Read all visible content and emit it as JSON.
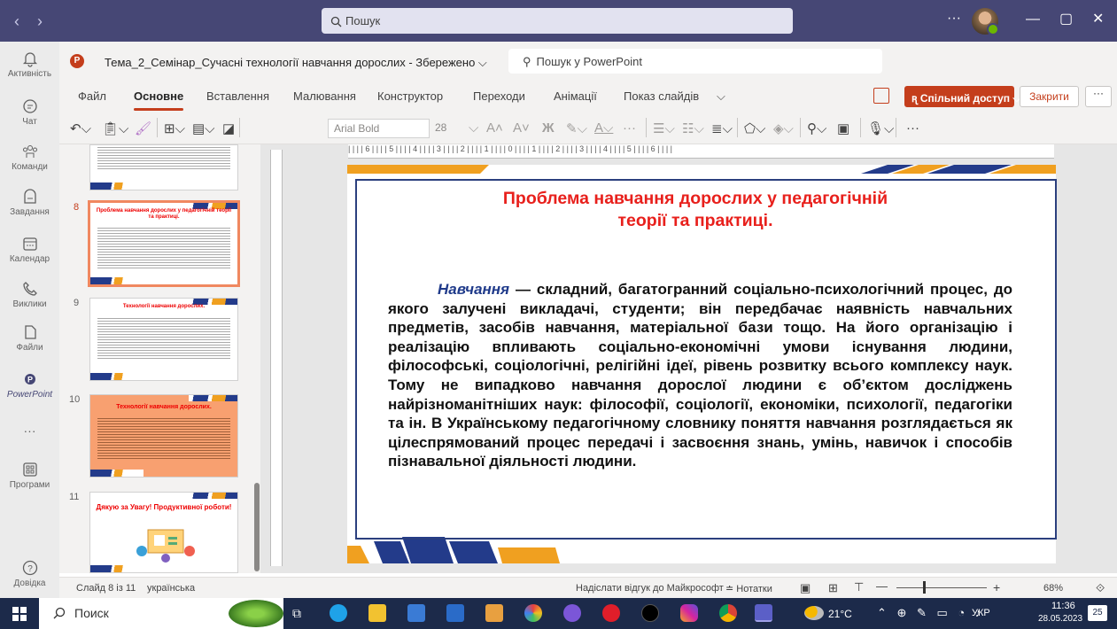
{
  "teams": {
    "search_placeholder": "Пошук",
    "more": "···"
  },
  "rail": [
    {
      "label": "Активність",
      "icon": "bell-icon"
    },
    {
      "label": "Чат",
      "icon": "chat-icon"
    },
    {
      "label": "Команди",
      "icon": "teams-icon"
    },
    {
      "label": "Завдання",
      "icon": "assignments-icon"
    },
    {
      "label": "Календар",
      "icon": "calendar-icon"
    },
    {
      "label": "Виклики",
      "icon": "phone-icon"
    },
    {
      "label": "Файли",
      "icon": "files-icon"
    },
    {
      "label": "PowerPoint",
      "icon": "powerpoint-icon"
    },
    {
      "label": "···",
      "icon": "more-icon"
    },
    {
      "label": "Програми",
      "icon": "apps-icon"
    },
    {
      "label": "Довідка",
      "icon": "help-icon"
    }
  ],
  "ppt": {
    "doc_title": "Тема_2_Семінар_Сучасні технології навчання дорослих  -  Збережено ⌵",
    "search": "Пошук у PowerPoint",
    "tabs": [
      "Файл",
      "Основне",
      "Вставлення",
      "Малювання",
      "Конструктор",
      "Переходи",
      "Анімації",
      "Показ слайдів",
      "⌵"
    ],
    "share": "Спільний доступ ⌵",
    "close": "Закрити",
    "more": "···",
    "font": "Arial Bold",
    "size": "28",
    "ruler": "| | | | 6 | | | | 5 | | | | 4 | | | | 3 | | | | 2 | | | | 1 | | | | 0 | | | | 1 | | | | 2 | | | | 3 | | | | 4 | | | | 5 | | | | 6 | | | |"
  },
  "thumbs": [
    {
      "num": "8",
      "title": "Проблема навчання дорослих у педагогічній теорії та практиці."
    },
    {
      "num": "9",
      "title": "Технології навчання дорослих."
    },
    {
      "num": "10",
      "title": "Технології навчання дорослих."
    },
    {
      "num": "11",
      "title": "Дякую за Увагу! Продуктивної роботи!"
    }
  ],
  "slide": {
    "title_l1": "Проблема навчання дорослих у педагогічній",
    "title_l2": "теорії та практиці.",
    "term": "Навчання",
    "body": " — складний, багатогранний соціально-психологічний процес, до якого залучені викладачі, студенти; він передбачає наявність навчальних предметів, засобів навчання, матеріальної бази тощо. На його організацію і реалізацію впливають соціально-економічні умови існування людини, філософські, соціологічні, релігійні ідеї, рівень розвитку всього комплексу наук. Тому не випадково навчання  дорослої людини є об’єктом досліджень найрізноманітніших наук: філософії, соціології, економіки, психології, педагогіки та ін. В Українському педагогічному словнику поняття навчання розглядається як цілеспрямований процес передачі і засвоєння знань, умінь, навичок і способів пізнавальної діяльності людини."
  },
  "status": {
    "slide": "Слайд 8 із 11",
    "lang": "українська",
    "feedback": "Надіслати відгук до Майкрософт",
    "notes": "≐ Нотатки",
    "zoom": "68%"
  },
  "taskbar": {
    "search": "Поиск",
    "weather": "21°C",
    "lang": "УКР",
    "time": "11:36",
    "date": "28.05.2023",
    "notif": "25"
  }
}
